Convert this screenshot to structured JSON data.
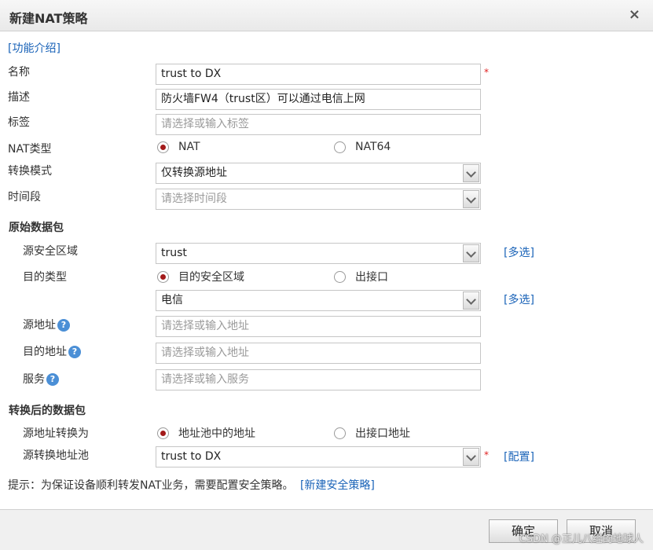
{
  "dialog": {
    "title": "新建NAT策略",
    "close_symbol": "×"
  },
  "intro_link": "[功能介绍]",
  "fields": {
    "name": {
      "label": "名称",
      "value": "trust to DX",
      "required": "*"
    },
    "description": {
      "label": "描述",
      "value": "防火墙FW4（trust区）可以通过电信上网"
    },
    "tags": {
      "label": "标签",
      "placeholder": "请选择或输入标签"
    },
    "nat_type": {
      "label": "NAT类型",
      "options": [
        "NAT",
        "NAT64"
      ],
      "selected": "NAT"
    },
    "convert_mode": {
      "label": "转换模式",
      "value": "仅转换源地址"
    },
    "time_range": {
      "label": "时间段",
      "placeholder": "请选择时间段"
    }
  },
  "original_packet": {
    "heading": "原始数据包",
    "source_zone": {
      "label": "源安全区域",
      "value": "trust",
      "link": "[多选]"
    },
    "dest_type": {
      "label": "目的类型",
      "options": [
        "目的安全区域",
        "出接口"
      ],
      "selected": "目的安全区域"
    },
    "dest_zone": {
      "value": "电信",
      "link": "[多选]"
    },
    "source_address": {
      "label": "源地址",
      "placeholder": "请选择或输入地址"
    },
    "dest_address": {
      "label": "目的地址",
      "placeholder": "请选择或输入地址"
    },
    "service": {
      "label": "服务",
      "placeholder": "请选择或输入服务"
    },
    "help_symbol": "?"
  },
  "translated_packet": {
    "heading": "转换后的数据包",
    "source_translate_to": {
      "label": "源地址转换为",
      "options": [
        "地址池中的地址",
        "出接口地址"
      ],
      "selected": "地址池中的地址"
    },
    "source_pool": {
      "label": "源转换地址池",
      "value": "trust to DX",
      "required": "*",
      "link": "[配置]"
    }
  },
  "hint": {
    "text": "提示：为保证设备顺利转发NAT业务，需要配置安全策略。",
    "link": "[新建安全策略]"
  },
  "buttons": {
    "ok": "确定",
    "cancel": "取消"
  },
  "watermark": "CSDN @正儿八经的地球人",
  "colors": {
    "link": "#1a63b8",
    "required": "#e02020",
    "radio_selected": "#a31a1a"
  }
}
